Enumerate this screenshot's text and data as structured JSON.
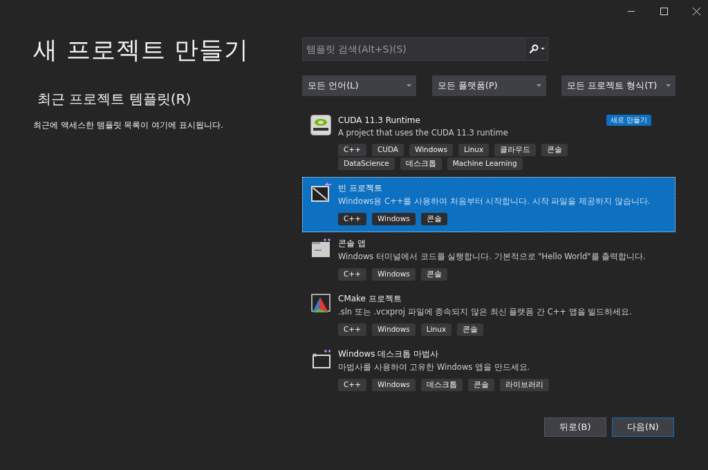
{
  "window": {
    "title": "새 프로젝트 만들기"
  },
  "recent": {
    "heading": "최근 프로젝트 템플릿(R)",
    "message": "최근에 액세스한 템플릿 목록이 여기에 표시됩니다."
  },
  "search": {
    "placeholder": "템플릿 검색(Alt+S)(S)"
  },
  "filters": [
    "모든 언어(L)",
    "모든 플랫폼(P)",
    "모든 프로젝트 형식(T)"
  ],
  "templates": [
    {
      "kind": "nvidia",
      "name": "CUDA 11.3 Runtime",
      "description": "A project that uses the CUDA 11.3 runtime",
      "badge": "새로 만들기",
      "selected": false,
      "tags": [
        "C++",
        "CUDA",
        "Windows",
        "Linux",
        "클라우드",
        "콘솔",
        "DataScience",
        "데스크톱",
        "Machine Learning"
      ]
    },
    {
      "kind": "empty",
      "name": "빈 프로젝트",
      "description": "Windows용 C++를 사용하여 처음부터 시작합니다. 시작 파일을 제공하지 않습니다.",
      "selected": true,
      "tags": [
        "C++",
        "Windows",
        "콘솔"
      ]
    },
    {
      "kind": "console",
      "name": "콘솔 앱",
      "description": "Windows 터미널에서 코드를 실행합니다. 기본적으로 \"Hello World\"를 출력합니다.",
      "selected": false,
      "tags": [
        "C++",
        "Windows",
        "콘솔"
      ]
    },
    {
      "kind": "cmake",
      "name": "CMake 프로젝트",
      "description": ".sln 또는 .vcxproj 파일에 종속되지 않은 최신 플랫폼 간 C++ 앱을 빌드하세요.",
      "selected": false,
      "tags": [
        "C++",
        "Windows",
        "Linux",
        "콘솔"
      ]
    },
    {
      "kind": "wizard",
      "name": "Windows 데스크톱 마법사",
      "description": "마법사를 사용하여 고유한 Windows 앱을 만드세요.",
      "selected": false,
      "tags": [
        "C++",
        "Windows",
        "데스크톱",
        "콘솔",
        "라이브러리"
      ]
    }
  ],
  "buttons": [
    {
      "label": "뒤로(B)",
      "primary": false
    },
    {
      "label": "다음(N)",
      "primary": true
    }
  ]
}
